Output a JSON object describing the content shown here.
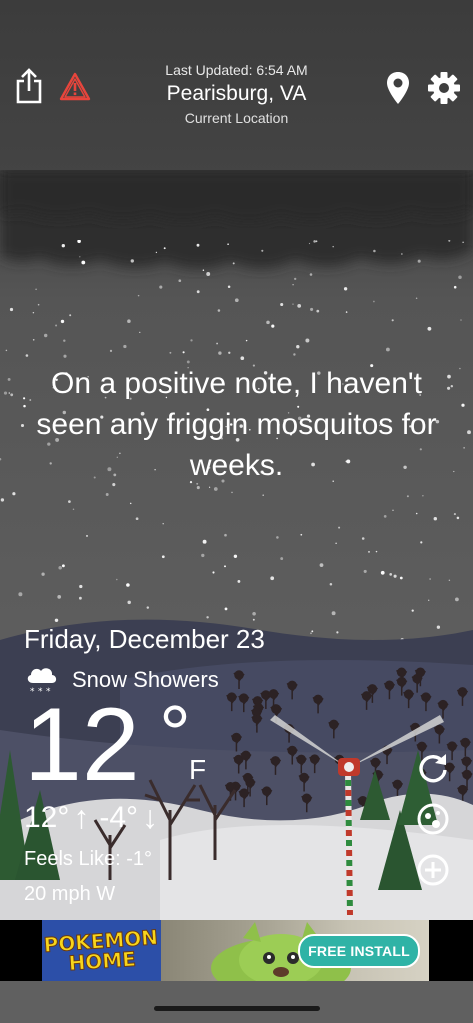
{
  "header": {
    "last_updated": "Last Updated: 6:54 AM",
    "city": "Pearisburg, VA",
    "location_label": "Current Location"
  },
  "icons": {
    "share": "share-icon",
    "alert": "warning-triangle-icon",
    "location": "map-pin-icon",
    "settings": "gear-icon",
    "refresh": "refresh-icon",
    "radar": "radar-icon",
    "add": "plus-circle-icon"
  },
  "quote": "On a positive note, I haven't seen any friggin mosquitos for weeks.",
  "weather": {
    "date": "Friday, December 23",
    "condition": "Snow Showers",
    "temperature": "12",
    "degree": "°",
    "unit": "F",
    "high": "12°",
    "low": "-4°",
    "feels_like": "Feels Like: -1°",
    "wind": "20 mph W"
  },
  "ad": {
    "brand": "POKEMON HOME",
    "cta": "FREE INSTALL"
  },
  "colors": {
    "ad_cta": "#2fb3a6",
    "alert_red": "#e8453c"
  }
}
